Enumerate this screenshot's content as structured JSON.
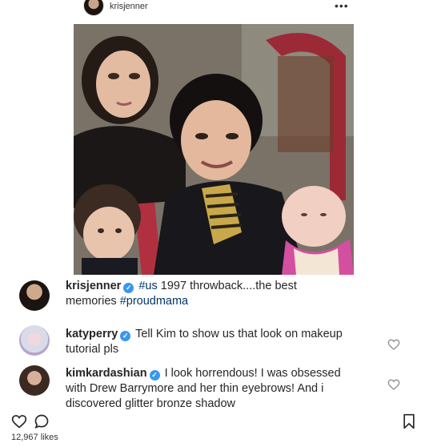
{
  "header": {
    "username": "krisjenner",
    "more_label": "•••"
  },
  "caption": {
    "username": "krisjenner",
    "text_plain_1": " ",
    "hashtag_1": "#us",
    "text_plain_2": " 1997 throwback....the best",
    "text_plain_3": "memories ",
    "hashtag_2": "#proudmama"
  },
  "comments": [
    {
      "username": "katyperry",
      "line1": "Tell Kim to show us that look on makeup",
      "line2": "tutorial pls"
    },
    {
      "username": "kimkardashian",
      "line1": "I look horrendous! I was obsessed",
      "line2": "with Drew Barrymore and her thin eyebrows! And i",
      "line3": "discovered glitter bronze shadow"
    }
  ],
  "likes": {
    "label": "12,967 likes"
  },
  "colors": {
    "verified": "#3897f0",
    "hashtag": "#003569",
    "text": "#262626"
  }
}
